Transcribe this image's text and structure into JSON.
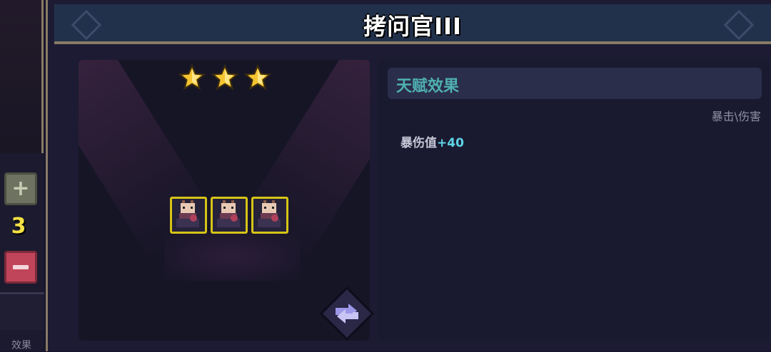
{
  "title": "拷问官III",
  "side": {
    "plus_symbol": "+",
    "count": "3",
    "bottom_label": "效果"
  },
  "stage": {
    "stars": 3,
    "unit_count": 3
  },
  "talent": {
    "header": "天赋效果",
    "tags": "暴击\\伤害",
    "effect_label": "暴伤值",
    "effect_value": "+40"
  },
  "colors": {
    "title_bar": "#22314b",
    "frame_border": "#8a7a66",
    "star": "#f5c531",
    "unit_border": "#d6c416",
    "talent_title": "#4fb0b1",
    "effect_value": "#5fd3e6",
    "count": "#f3e043"
  }
}
